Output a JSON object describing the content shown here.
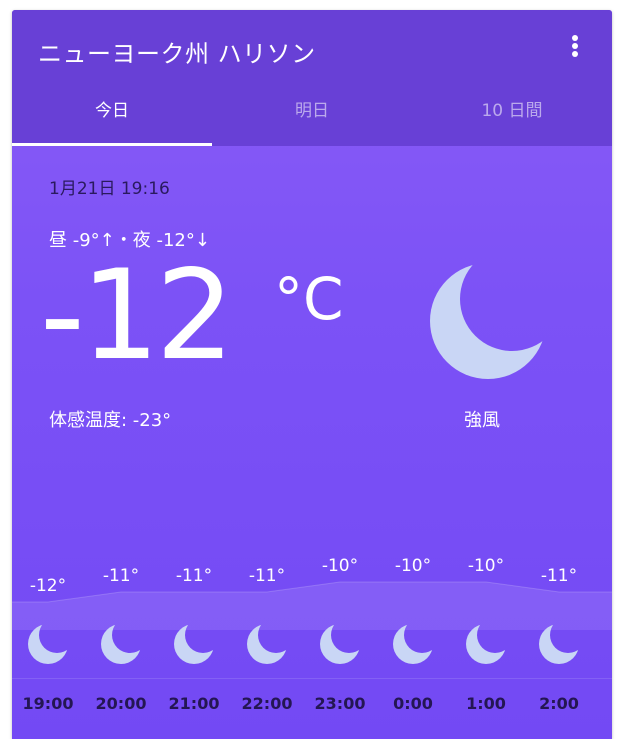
{
  "header": {
    "location": "ニューヨーク州 ハリソン",
    "menu_icon": "more-vert-icon"
  },
  "tabs": [
    {
      "label": "今日",
      "active": true
    },
    {
      "label": "明日",
      "active": false
    },
    {
      "label": "10 日間",
      "active": false
    }
  ],
  "current": {
    "datetime": "1月21日 19:16",
    "hilo": "昼 -9°↑・夜 -12°↓",
    "temperature": "-12",
    "unit": "°C",
    "feels_like": "体感温度: -23°",
    "condition": "強風",
    "icon": "moon-icon"
  },
  "hourly": [
    {
      "time": "19:00",
      "temp": "-12°",
      "value": -12,
      "icon": "moon-icon"
    },
    {
      "time": "20:00",
      "temp": "-11°",
      "value": -11,
      "icon": "moon-icon"
    },
    {
      "time": "21:00",
      "temp": "-11°",
      "value": -11,
      "icon": "moon-icon"
    },
    {
      "time": "22:00",
      "temp": "-11°",
      "value": -11,
      "icon": "moon-icon"
    },
    {
      "time": "23:00",
      "temp": "-10°",
      "value": -10,
      "icon": "moon-icon"
    },
    {
      "time": "0:00",
      "temp": "-10°",
      "value": -10,
      "icon": "moon-icon"
    },
    {
      "time": "1:00",
      "temp": "-10°",
      "value": -10,
      "icon": "moon-icon"
    },
    {
      "time": "2:00",
      "temp": "-11°",
      "value": -11,
      "icon": "moon-icon"
    }
  ],
  "colors": {
    "header": "#6840d6",
    "background": "#7c52f6",
    "moon": "#c9d6f5",
    "dark_text": "#241653"
  }
}
